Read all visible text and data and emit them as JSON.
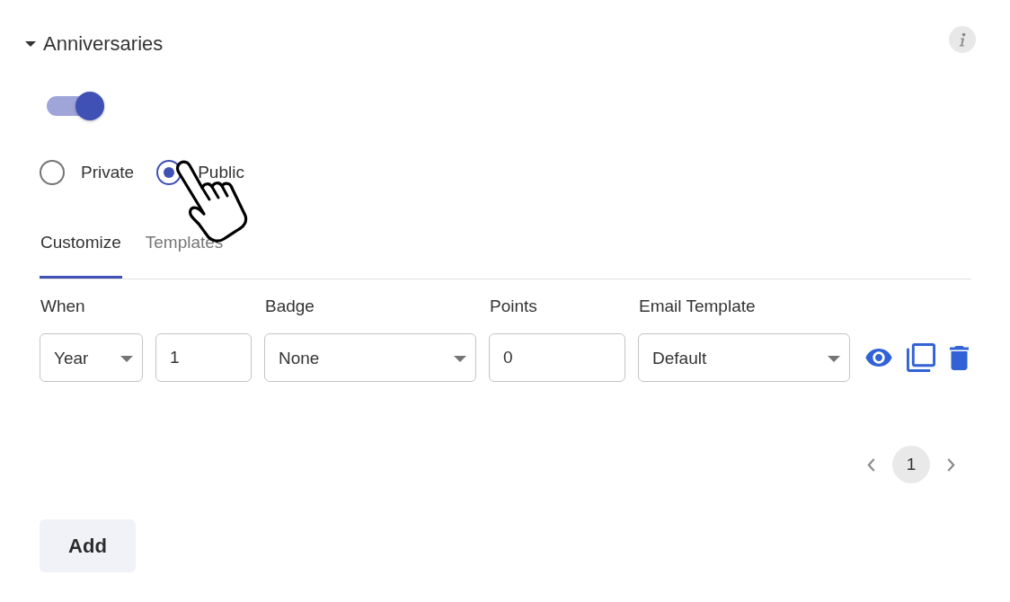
{
  "section": {
    "title": "Anniversaries",
    "expanded": true
  },
  "enabled_toggle": {
    "on": true
  },
  "visibility": [
    {
      "label": "Private",
      "selected": false
    },
    {
      "label": "Public",
      "selected": true
    }
  ],
  "tabs": [
    {
      "label": "Customize",
      "selected": true
    },
    {
      "label": "Templates",
      "selected": false
    }
  ],
  "table": {
    "columns": [
      "When",
      "Badge",
      "Points",
      "Email Template"
    ],
    "rows": [
      {
        "groups": [
          {
            "fields": [
              {
                "kind": "select",
                "value": "Year"
              },
              {
                "kind": "input",
                "value": "1"
              }
            ]
          },
          {
            "fields": [
              {
                "kind": "select",
                "value": "None"
              }
            ]
          },
          {
            "fields": [
              {
                "kind": "input",
                "value": "0"
              }
            ]
          },
          {
            "fields": [
              {
                "kind": "select",
                "value": "Default"
              }
            ]
          }
        ]
      }
    ]
  },
  "pagination": {
    "pages": [
      {
        "label": "1",
        "selected": true
      }
    ]
  },
  "add_button": {
    "label": "Add"
  }
}
